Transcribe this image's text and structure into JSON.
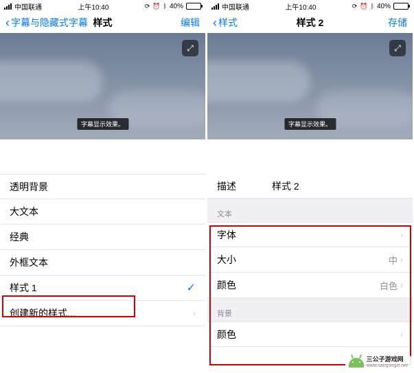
{
  "status": {
    "carrier": "中国联通",
    "time": "上午10:40",
    "battery_pct": "40%"
  },
  "left": {
    "nav_back": "字幕与隐藏式字幕",
    "nav_title": "样式",
    "nav_action": "编辑",
    "caption_sample": "字幕显示效果。",
    "rows": [
      "透明背景",
      "大文本",
      "经典",
      "外框文本",
      "样式 1",
      "创建新的样式..."
    ]
  },
  "right": {
    "nav_back": "样式",
    "nav_title": "样式 2",
    "nav_action": "存储",
    "caption_sample": "字幕显示效果。",
    "desc_label": "描述",
    "desc_value": "样式 2",
    "section_text": "文本",
    "text_rows": {
      "font": "字体",
      "size": "大小",
      "size_val": "中",
      "color": "颜色",
      "color_val": "白色"
    },
    "section_bg": "背景",
    "bg_rows": {
      "color": "颜色"
    }
  },
  "watermark": {
    "name": "三公子游戏网",
    "url": "www.sangongzi.net"
  }
}
